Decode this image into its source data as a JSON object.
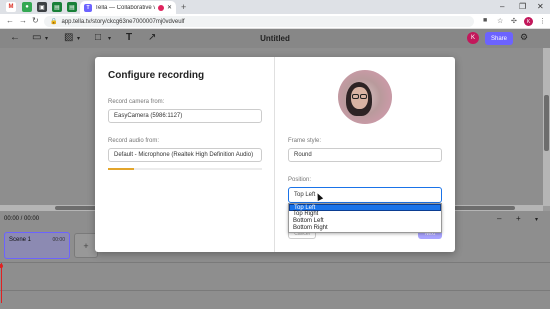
{
  "browser": {
    "tab_title": "Tella — Collaborative video",
    "url": "app.tella.tv/story/ckcg63ne7000007mj0vdveulf",
    "new_tab": "+",
    "window_controls": [
      "–",
      "❐",
      "✕"
    ],
    "favicons": [
      "gmail-icon",
      "green-app-icon",
      "bookmark-icon",
      "sheets-icon",
      "sheets-icon-2",
      "tella-icon"
    ],
    "profile_initial": "K"
  },
  "toolbar": {
    "document_title": "Untitled",
    "share_label": "Share",
    "avatar_initial": "K"
  },
  "modal": {
    "title": "Configure recording",
    "camera_label": "Record camera from:",
    "camera_value": "EasyCamera (5986:1127)",
    "audio_label": "Record audio from:",
    "audio_value": "Default - Microphone (Realtek High Definition Audio)",
    "audio_level": 0.17,
    "frame_style_label": "Frame style:",
    "frame_style_value": "Round",
    "position_label": "Position:",
    "position_value": "Top Left",
    "position_options": [
      "Top Left",
      "Top Right",
      "Bottom Left",
      "Bottom Right"
    ],
    "cancel_label": "Cancel",
    "next_label": "Next"
  },
  "timeline": {
    "timecode": "00:00 / 00:00",
    "scene_label": "Scene 1",
    "scene_duration": "00:00",
    "zoom_out": "–",
    "zoom_in": "+"
  },
  "colors": {
    "accent": "#6c63ff",
    "avatar": "#c2185b",
    "dropdown_selected": "#1a73e8",
    "playhead": "#e02020"
  }
}
